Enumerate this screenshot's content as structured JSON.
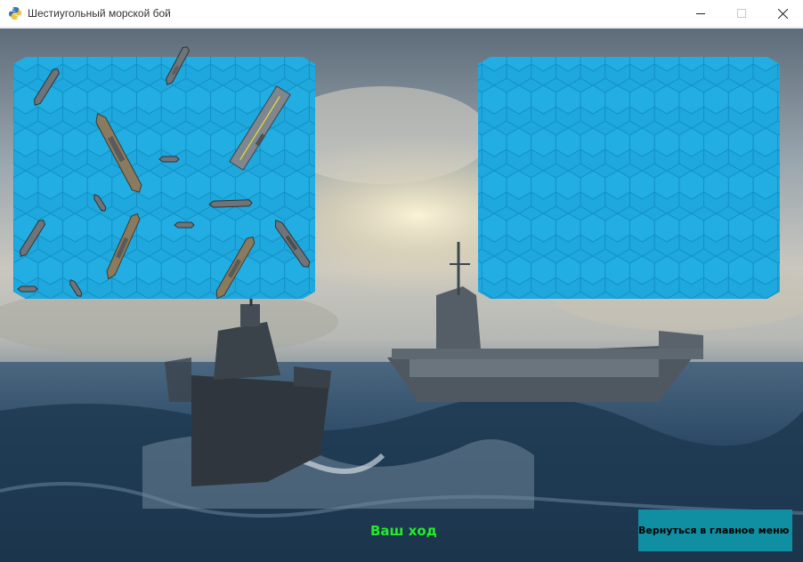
{
  "window": {
    "title": "Шестиугольный морской бой",
    "icon": "python-icon",
    "controls": [
      "minimize-icon",
      "maximize-icon",
      "close-icon"
    ]
  },
  "game": {
    "turn_text": "Ваш ход",
    "back_button_label": "Вернуться в главное меню",
    "colors": {
      "board": "#1ea8dd",
      "hex_edge": "#138fc4",
      "turn_text": "#22ee22",
      "button": "#108fa3"
    },
    "player_board": {
      "cols": 12,
      "rows": 10,
      "ships_visible": 15
    },
    "enemy_board": {
      "cols": 12,
      "rows": 10,
      "ships_visible": 0
    }
  }
}
